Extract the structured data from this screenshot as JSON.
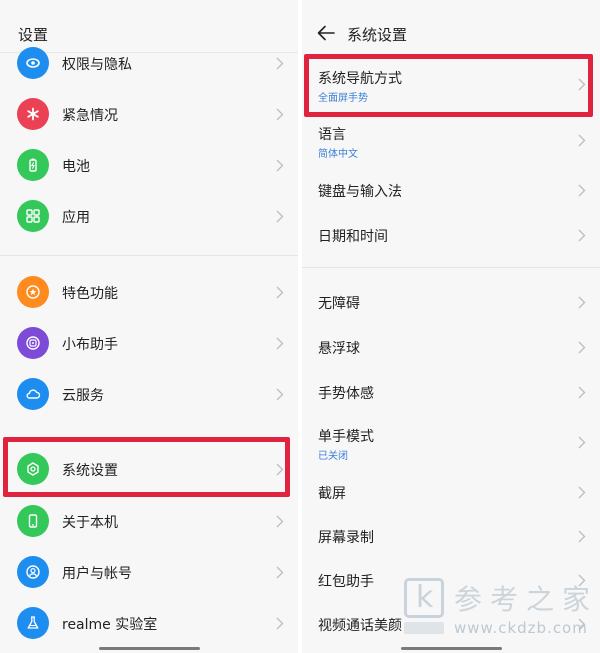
{
  "left": {
    "title": "设置",
    "items": [
      {
        "label": "权限与隐私",
        "icon": "privacy-icon",
        "color": "#1e8df0"
      },
      {
        "label": "紧急情况",
        "icon": "emergency-icon",
        "color": "#ea4154"
      },
      {
        "label": "电池",
        "icon": "battery-icon",
        "color": "#34c759"
      },
      {
        "label": "应用",
        "icon": "apps-grid-icon",
        "color": "#34c759"
      },
      {
        "label": "特色功能",
        "icon": "star-icon",
        "color": "#ff8a1e"
      },
      {
        "label": "小布助手",
        "icon": "assistant-icon",
        "color": "#7d4bd8"
      },
      {
        "label": "云服务",
        "icon": "cloud-icon",
        "color": "#1e8df0"
      },
      {
        "label": "系统设置",
        "icon": "gear-icon",
        "color": "#34c759"
      },
      {
        "label": "关于本机",
        "icon": "phone-icon",
        "color": "#34c759"
      },
      {
        "label": "用户与帐号",
        "icon": "user-icon",
        "color": "#1e8df0"
      },
      {
        "label": "realme 实验室",
        "icon": "flask-icon",
        "color": "#1e8df0"
      }
    ]
  },
  "right": {
    "title": "系统设置",
    "items": [
      {
        "label": "系统导航方式",
        "sub": "全面屏手势"
      },
      {
        "label": "语言",
        "sub": "简体中文"
      },
      {
        "label": "键盘与输入法",
        "sub": ""
      },
      {
        "label": "日期和时间",
        "sub": ""
      },
      {
        "label": "无障碍",
        "sub": ""
      },
      {
        "label": "悬浮球",
        "sub": ""
      },
      {
        "label": "手势体感",
        "sub": ""
      },
      {
        "label": "单手模式",
        "sub": "已关闭"
      },
      {
        "label": "截屏",
        "sub": ""
      },
      {
        "label": "屏幕录制",
        "sub": ""
      },
      {
        "label": "红包助手",
        "sub": ""
      },
      {
        "label": "视频通话美颜",
        "sub": ""
      }
    ]
  },
  "watermark": {
    "logo_letter": "k",
    "title": "参考之家",
    "url": "www.ckdzb.com"
  },
  "colors": {
    "highlight": "#e0233f",
    "subtext": "#3b7fd6"
  }
}
